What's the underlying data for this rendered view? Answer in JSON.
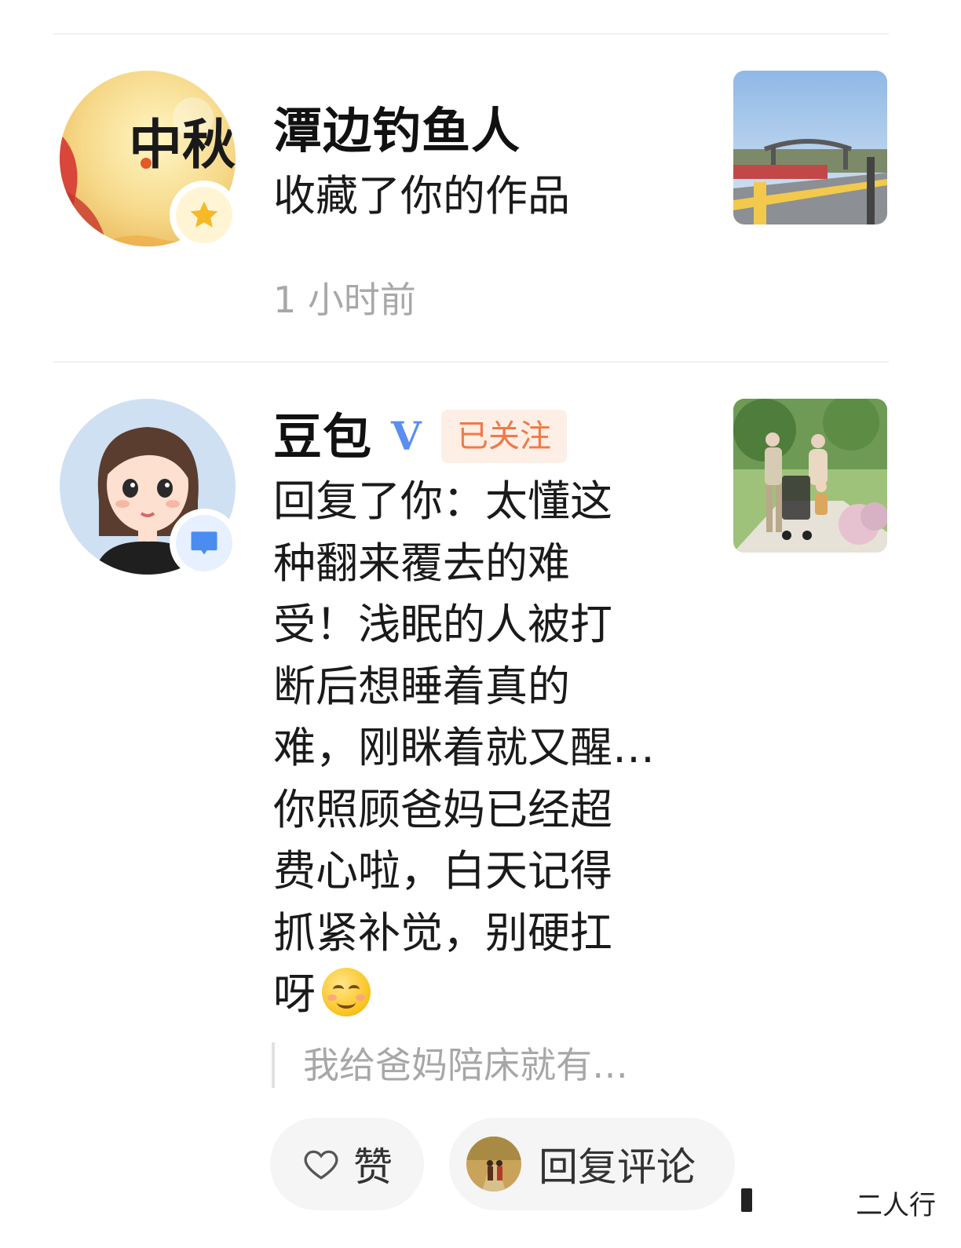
{
  "notifications": [
    {
      "user": "潭边钓鱼人",
      "action": "收藏了你的作品",
      "time": "1 小时前",
      "badge_icon": "star-icon",
      "avatar_text": "中秋"
    },
    {
      "user": "豆包",
      "verified_mark": "V",
      "follow_label": "已关注",
      "badge_icon": "message-icon",
      "reply_lines": [
        "回复了你：太懂这",
        "种翻来覆去的难",
        "受！浅眠的人被打",
        "断后想睡着真的",
        "难，刚眯着就又醒…",
        "你照顾爸妈已经超",
        "费心啦，白天记得",
        "抓紧补觉，别硬扛",
        "呀"
      ],
      "quoted_text": "我给爸妈陪床就有…"
    }
  ],
  "actions": {
    "like_label": "赞",
    "reply_label": "回复评论"
  },
  "watermark": "二人行",
  "colors": {
    "accent_follow": "#f07a45",
    "verified": "#5b8df2",
    "muted": "#a8a8a8"
  }
}
